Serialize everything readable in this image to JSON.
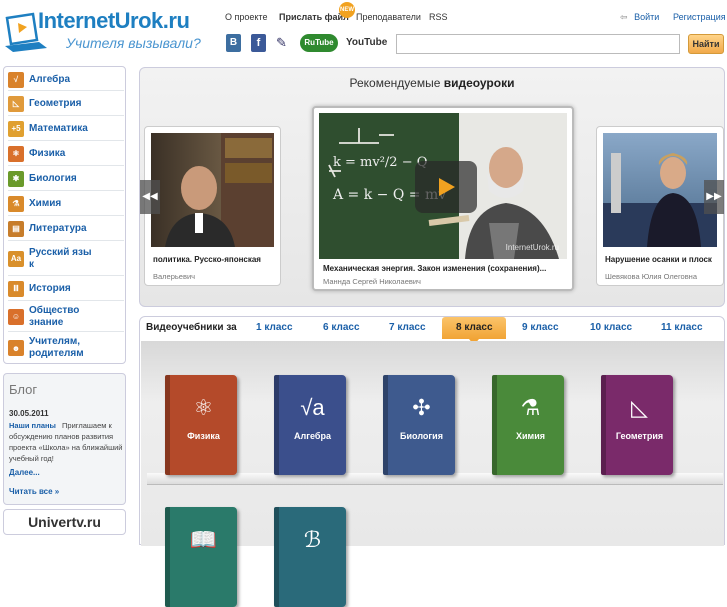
{
  "header": {
    "logo_title": "InternetUrok.ru",
    "logo_subtitle": "Учителя вызывали?",
    "nav": [
      "О проекте",
      "Прислать файл",
      "Преподаватели",
      "RSS"
    ],
    "new_badge": "NEW",
    "login": "Войти",
    "register": "Регистрация",
    "search_placeholder": "",
    "search_button": "Найти",
    "social": [
      "В",
      "f",
      "✎",
      "RuTube",
      "YouTube"
    ]
  },
  "sidebar": {
    "items": [
      {
        "label": "Алгебра",
        "icon": "sqrt-icon",
        "color": "#d9822b"
      },
      {
        "label": "Геометрия",
        "icon": "triangle-icon",
        "color": "#e09a3b"
      },
      {
        "label": "Математика",
        "icon": "plus-five-icon",
        "color": "#e0a030"
      },
      {
        "label": "Физика",
        "icon": "atom-icon",
        "color": "#d9702b"
      },
      {
        "label": "Биология",
        "icon": "bug-icon",
        "color": "#6a9a2b"
      },
      {
        "label": "Химия",
        "icon": "flask-icon",
        "color": "#d98a2b"
      },
      {
        "label": "Литература",
        "icon": "book-icon",
        "color": "#c77d2b"
      },
      {
        "label": "Русский язы к",
        "icon": "letters-icon",
        "color": "#d9902b"
      },
      {
        "label": "История",
        "icon": "columns-icon",
        "color": "#d98a2b"
      },
      {
        "label": "Общество знание",
        "icon": "people-icon",
        "color": "#d9702b"
      },
      {
        "label": "Учителям, родителям",
        "icon": "teacher-icon",
        "color": "#d9822b"
      }
    ]
  },
  "blog": {
    "title": "Блог",
    "date": "30.05.2011",
    "headline": "Наши планы",
    "text": "Приглашаем к обсуждению планов развития проекта «Школа» на ближайший учебный год!",
    "more": "Далее...",
    "read_all": "Читать все »"
  },
  "univer": "Univertv.ru",
  "featured": {
    "title_prefix": "Рекомендуемые ",
    "title_bold": "видеоуроки",
    "prev": "◀◀",
    "next": "▶▶",
    "cards": [
      {
        "title": "политика. Русско-японская",
        "author": "Валерьевич"
      },
      {
        "title": "Механическая энергия. Закон изменения (сохранения)...",
        "author": "Маннда Сергей Николаевич",
        "watermark": "InternetUrok.ru"
      },
      {
        "title": "Нарушение осанки и плоск",
        "author": "Шевякова Юлия Олеговна"
      }
    ],
    "board_text": [
      "k = mv²/2 − Q",
      "A = k − Q = mv"
    ]
  },
  "grades": {
    "label": "Видеоучебники за",
    "tabs": [
      "1 класс",
      "6 класс",
      "7 класс",
      "8 класс",
      "9 класс",
      "10 класс",
      "11 класс"
    ],
    "active_index": 3
  },
  "books": [
    {
      "label": "Физика",
      "color": "#b44a2a",
      "icon": "atom-icon",
      "glyph": "⚛"
    },
    {
      "label": "Алгебра",
      "color": "#3b4f8c",
      "icon": "sqrt-icon",
      "glyph": "√a"
    },
    {
      "label": "Биология",
      "color": "#3e5a8e",
      "icon": "dna-icon",
      "glyph": "✣"
    },
    {
      "label": "Химия",
      "color": "#4a8a3a",
      "icon": "flask-icon",
      "glyph": "⚗"
    },
    {
      "label": "Геометрия",
      "color": "#7a2a6a",
      "icon": "triangle-icon",
      "glyph": "◺"
    },
    {
      "label": "",
      "color": "#2a7a6a",
      "icon": "book-icon",
      "glyph": "📖"
    },
    {
      "label": "",
      "color": "#2a6a7a",
      "icon": "letters-icon",
      "glyph": "ℬ"
    }
  ]
}
